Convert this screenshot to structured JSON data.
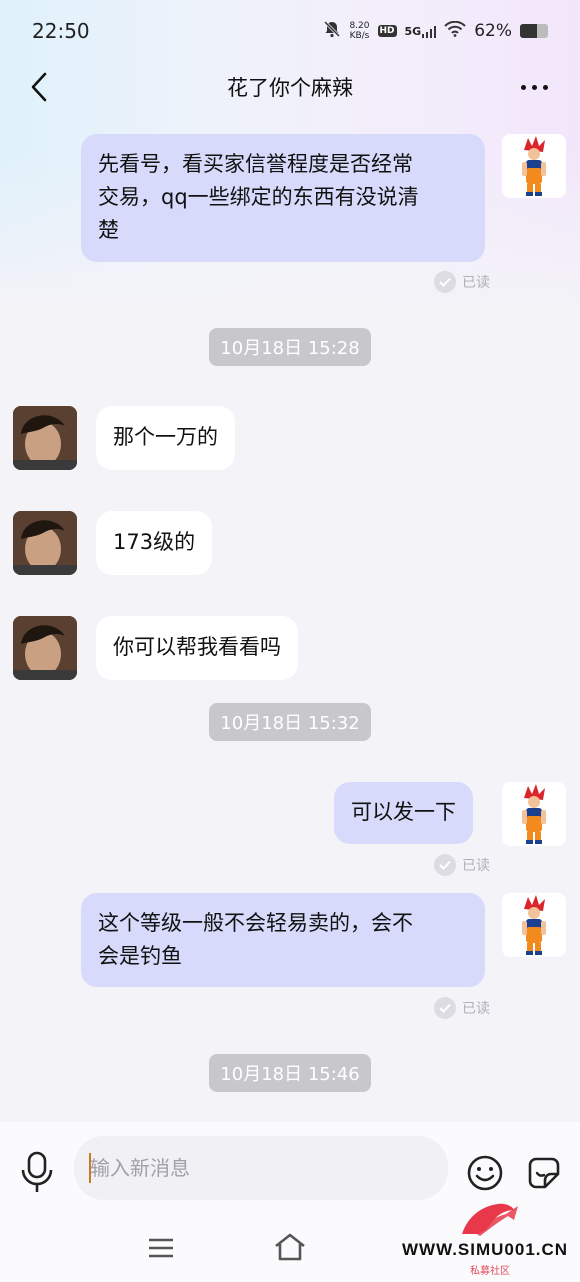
{
  "status_bar": {
    "time": "22:50",
    "speed_value": "8.20",
    "speed_unit": "KB/s",
    "hd": "HD",
    "network": "5G",
    "battery": "62%",
    "battery_level": 0.62
  },
  "header": {
    "title": "花了你个麻辣"
  },
  "messages": [
    {
      "text_lines": [
        "先看号，看买家信誉程度是否经常",
        "交易，qq一些绑定的东西有没说清",
        "楚"
      ],
      "read": "已读"
    },
    {
      "timestamp": "10月18日 15:28"
    },
    {
      "text": "那个一万的"
    },
    {
      "text": "173级的"
    },
    {
      "text": "你可以帮我看看吗"
    },
    {
      "timestamp": "10月18日 15:32"
    },
    {
      "text": "可以发一下",
      "read": "已读"
    },
    {
      "text_lines": [
        "这个等级一般不会轻易卖的，会不",
        "会是钓鱼"
      ],
      "read": "已读"
    },
    {
      "timestamp": "10月18日 15:46"
    }
  ],
  "input": {
    "placeholder": "输入新消息"
  },
  "watermark": {
    "text": "WWW.SIMU001.CN",
    "sub": "私募社区"
  },
  "colors": {
    "my_bubble": "#d7dafb",
    "other_bubble": "#ffffff",
    "timestamp_bg": "#c8c8cc",
    "background": "#f3f3f8"
  }
}
